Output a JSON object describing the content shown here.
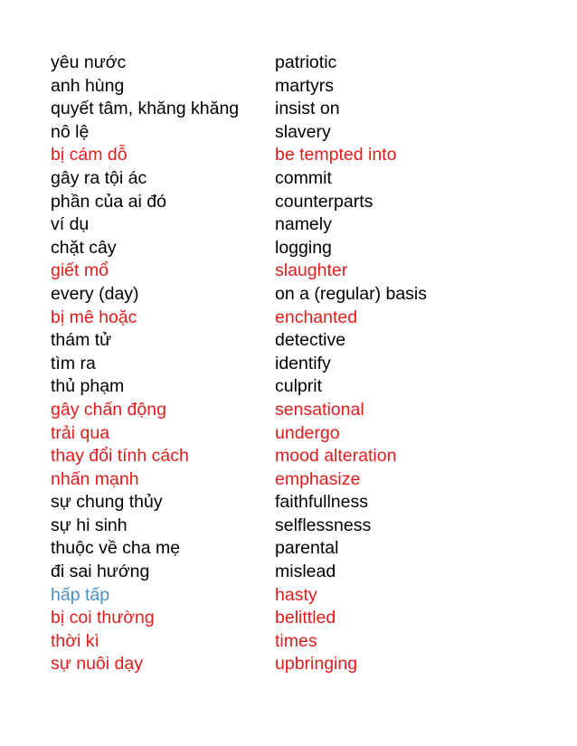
{
  "colors": {
    "black": "#000000",
    "red": "#e31b1b",
    "blue": "#4a90c8"
  },
  "vocabulary": [
    {
      "vi": "yêu nước",
      "en": "patriotic",
      "vi_color": "black",
      "en_color": "black"
    },
    {
      "vi": "anh hùng",
      "en": "martyrs",
      "vi_color": "black",
      "en_color": "black"
    },
    {
      "vi": "quyết tâm, khăng khăng",
      "en": "insist on",
      "vi_color": "black",
      "en_color": "black"
    },
    {
      "vi": "nô lệ",
      "en": "slavery",
      "vi_color": "black",
      "en_color": "black"
    },
    {
      "vi": "bị cám dỗ",
      "en": "be tempted into",
      "vi_color": "red",
      "en_color": "red"
    },
    {
      "vi": "gây ra tội ác",
      "en": "commit",
      "vi_color": "black",
      "en_color": "black"
    },
    {
      "vi": "phần của ai đó",
      "en": "counterparts",
      "vi_color": "black",
      "en_color": "black"
    },
    {
      "vi": "ví dụ",
      "en": "namely",
      "vi_color": "black",
      "en_color": "black"
    },
    {
      "vi": "chặt cây",
      "en": "logging",
      "vi_color": "black",
      "en_color": "black"
    },
    {
      "vi": "giết mổ",
      "en": "slaughter",
      "vi_color": "red",
      "en_color": "red"
    },
    {
      "vi": "every (day)",
      "en": "on a (regular) basis",
      "vi_color": "black",
      "en_color": "black"
    },
    {
      "vi": "bị mê hoặc",
      "en": "enchanted",
      "vi_color": "red",
      "en_color": "red"
    },
    {
      "vi": "thám tử",
      "en": "detective",
      "vi_color": "black",
      "en_color": "black"
    },
    {
      "vi": "tìm ra",
      "en": "identify",
      "vi_color": "black",
      "en_color": "black"
    },
    {
      "vi": "thủ phạm",
      "en": "culprit",
      "vi_color": "black",
      "en_color": "black"
    },
    {
      "vi": "gây chấn động",
      "en": "sensational",
      "vi_color": "red",
      "en_color": "red"
    },
    {
      "vi": "trải qua",
      "en": "undergo",
      "vi_color": "red",
      "en_color": "red"
    },
    {
      "vi": "thay đổi tính cách",
      "en": "mood alteration",
      "vi_color": "red",
      "en_color": "red"
    },
    {
      "vi": "nhấn mạnh",
      "en": "emphasize",
      "vi_color": "red",
      "en_color": "red"
    },
    {
      "vi": "sự chung thủy",
      "en": "faithfullness",
      "vi_color": "black",
      "en_color": "black"
    },
    {
      "vi": "sự hi sinh",
      "en": "selflessness",
      "vi_color": "black",
      "en_color": "black"
    },
    {
      "vi": "thuộc về cha mẹ",
      "en": "parental",
      "vi_color": "black",
      "en_color": "black"
    },
    {
      "vi": "đi sai hướng",
      "en": "mislead",
      "vi_color": "black",
      "en_color": "black"
    },
    {
      "vi": "hấp tấp",
      "en": "hasty",
      "vi_color": "blue",
      "en_color": "red"
    },
    {
      "vi": "bị coi thường",
      "en": "belittled",
      "vi_color": "red",
      "en_color": "red"
    },
    {
      "vi": "thời kì",
      "en": "times",
      "vi_color": "red",
      "en_color": "red"
    },
    {
      "vi": "sự nuôi dạy",
      "en": "upbringing",
      "vi_color": "red",
      "en_color": "red"
    }
  ]
}
